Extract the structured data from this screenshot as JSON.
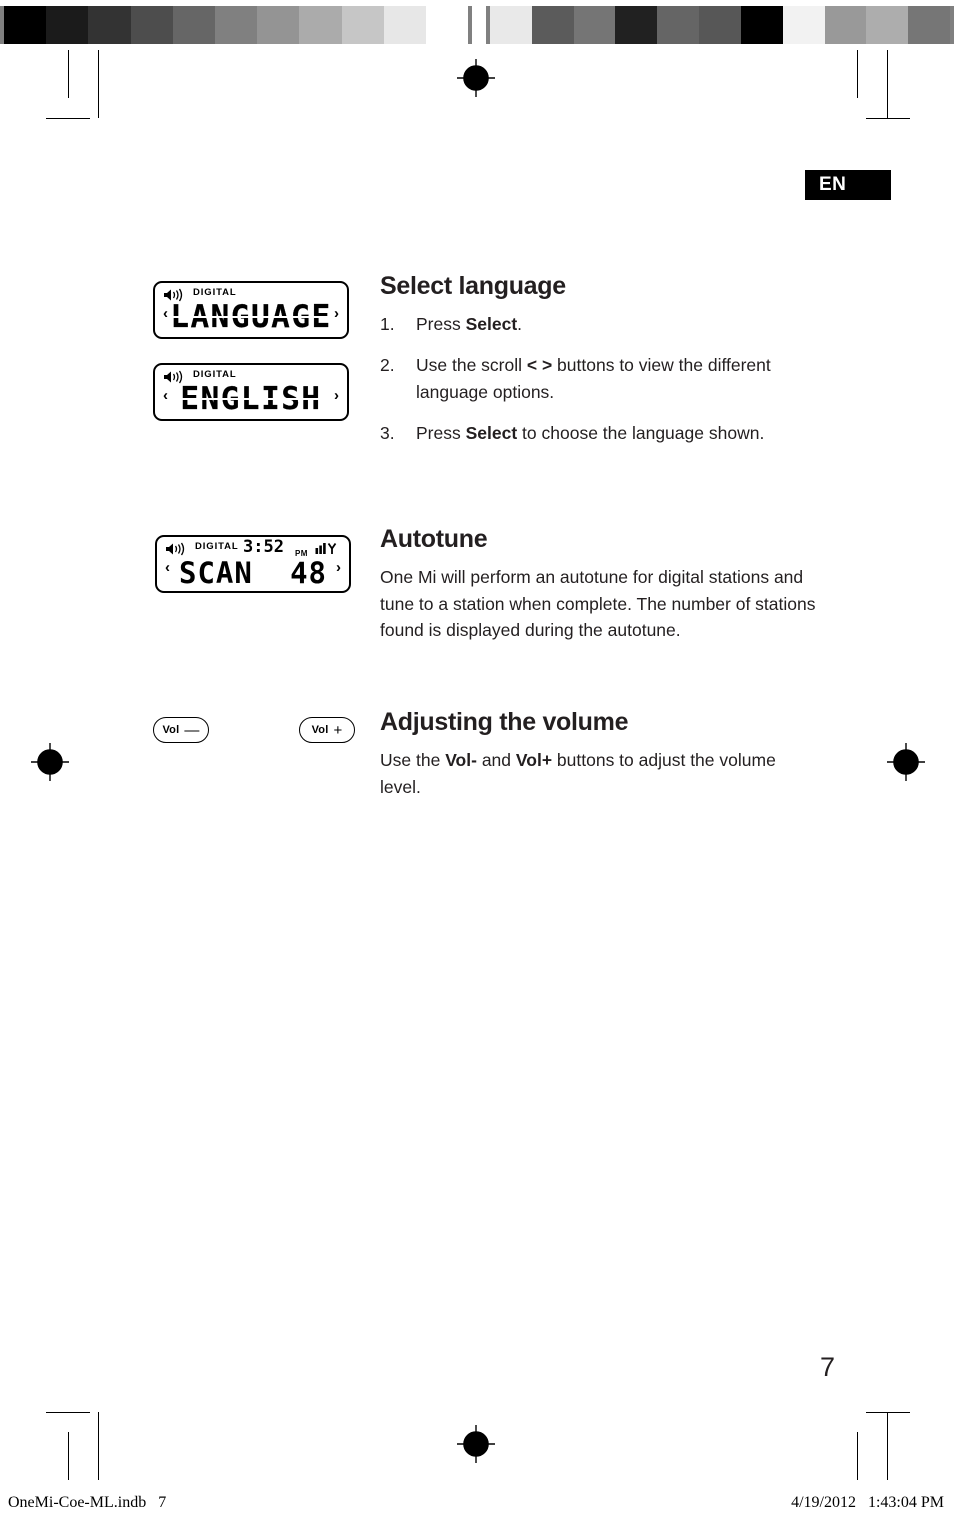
{
  "page": {
    "language_badge": "EN",
    "page_number": "7"
  },
  "footer": {
    "file_slug": "OneMi-Coe-ML.indb   7",
    "timestamp": "4/19/2012   1:43:04 PM"
  },
  "displays": [
    {
      "name": "language-display",
      "digital_label": "DIGITAL",
      "main_text": "LANGUAGE",
      "left_arrow": "‹",
      "right_arrow": "›",
      "speaker_icon": "speaker-icon"
    },
    {
      "name": "english-display",
      "digital_label": "DIGITAL",
      "main_text": "ENGLISH",
      "left_arrow": "‹",
      "right_arrow": "›",
      "speaker_icon": "speaker-icon"
    },
    {
      "name": "scan-display",
      "digital_label": "DIGITAL",
      "main_text": "SCAN",
      "station_count": "48",
      "time": "3:52",
      "ampm": "PM",
      "left_arrow": "‹",
      "right_arrow": "›",
      "speaker_icon": "speaker-icon",
      "signal_icon": "signal-antenna-icon"
    }
  ],
  "buttons": {
    "vol_down": {
      "label": "Vol",
      "sign": "—"
    },
    "vol_up": {
      "label": "Vol",
      "sign": "+"
    }
  },
  "sections": {
    "select_language": {
      "heading": "Select language",
      "steps": [
        {
          "num": "1.",
          "pre": "Press ",
          "bold": "Select",
          "post": "."
        },
        {
          "num": "2.",
          "pre": "Use the scroll ",
          "bold": "< >",
          "post": " buttons to view the different language options."
        },
        {
          "num": "3.",
          "pre": "Press ",
          "bold": "Select",
          "post": " to choose the language shown."
        }
      ]
    },
    "autotune": {
      "heading": "Autotune",
      "body": "One Mi will perform an autotune for digital stations and tune to a station when complete. The number of stations found is displayed during the autotune."
    },
    "adjusting_volume": {
      "heading": "Adjusting the volume",
      "pre": "Use the ",
      "bold1": "Vol-",
      "mid": " and ",
      "bold2": "Vol+",
      "post": " buttons to adjust the volume level."
    }
  },
  "calibration": {
    "left_bar": [
      "#000000",
      "#1b1b1b",
      "#333333",
      "#4d4d4d",
      "#666666",
      "#808080",
      "#949494",
      "#ababab",
      "#c6c6c6",
      "#e7e7e7",
      "#ffffff"
    ],
    "right_bar": [
      "#e9e9e9",
      "#5b5b5b",
      "#757575",
      "#212121",
      "#656565",
      "#575757",
      "#000000",
      "#f2f2f2",
      "#999999",
      "#adadad",
      "#767676"
    ],
    "bar_background": "#808080"
  }
}
